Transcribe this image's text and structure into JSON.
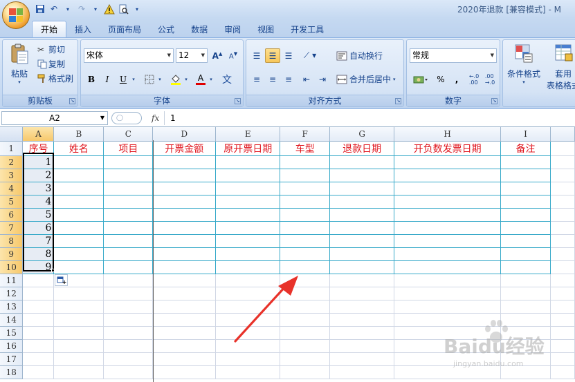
{
  "window": {
    "title": "2020年退款 [兼容模式] - M"
  },
  "tabs": [
    "开始",
    "插入",
    "页面布局",
    "公式",
    "数据",
    "审阅",
    "视图",
    "开发工具"
  ],
  "active_tab": "开始",
  "ribbon": {
    "clipboard": {
      "label": "剪贴板",
      "paste": "粘贴",
      "cut": "剪切",
      "copy": "复制",
      "format_painter": "格式刷"
    },
    "font": {
      "label": "字体",
      "font_name": "宋体",
      "font_size": "12",
      "bold": "B",
      "italic": "I",
      "underline": "U",
      "font_color_letter": "A",
      "phonetic": "文"
    },
    "alignment": {
      "label": "对齐方式",
      "wrap_text": "自动换行",
      "merge_center": "合并后居中"
    },
    "number": {
      "label": "数字",
      "format": "常规",
      "percent": "%",
      "comma": ","
    },
    "styles": {
      "conditional_format": "条件格式",
      "table_format_1": "套用",
      "table_format_2": "表格格式"
    }
  },
  "formula_bar": {
    "name_box": "A2",
    "fx_label": "fx",
    "content": "1"
  },
  "grid": {
    "columns": [
      "A",
      "B",
      "C",
      "D",
      "E",
      "F",
      "G",
      "H",
      "I"
    ],
    "headers": [
      "序号",
      "姓名",
      "项目",
      "开票金额",
      "原开票日期",
      "车型",
      "退款日期",
      "开负数发票日期",
      "备注"
    ],
    "row_numbers": [
      "1",
      "2",
      "3",
      "4",
      "5",
      "6",
      "7",
      "8",
      "9",
      "10",
      "11",
      "12",
      "13",
      "14",
      "15",
      "16",
      "17",
      "18"
    ],
    "serials": [
      "1",
      "2",
      "3",
      "4",
      "5",
      "6",
      "7",
      "8",
      "9"
    ]
  },
  "colors": {
    "header_text": "#e0161e",
    "border_accent": "#36a9c9",
    "selection_header": "#f7c86b",
    "annotation_arrow": "#e8322a"
  },
  "watermark": {
    "main": "Baidu经验",
    "sub": "jingyan.baidu.com"
  }
}
